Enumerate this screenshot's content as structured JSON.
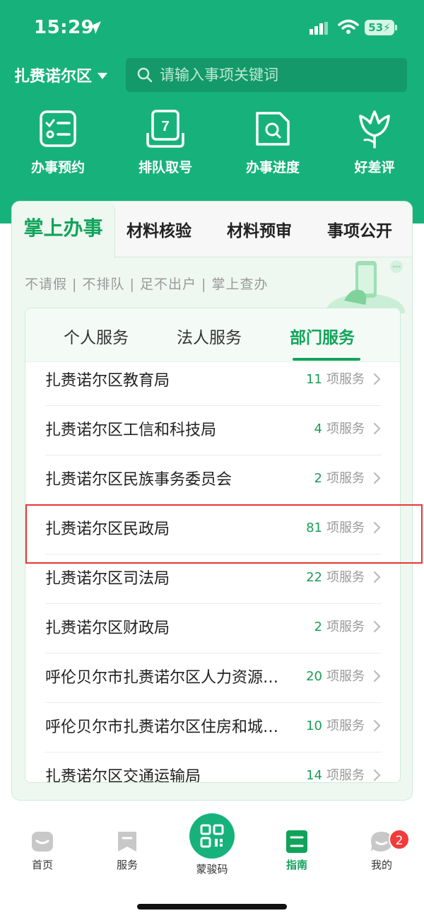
{
  "status_bar": {
    "time": "15:29",
    "battery": "53"
  },
  "header": {
    "region": "扎赉诺尔区",
    "search_placeholder": "请输入事项关键词"
  },
  "quick_actions": [
    {
      "label": "办事预约",
      "icon": "checklist-icon"
    },
    {
      "label": "排队取号",
      "icon": "queue-number-icon",
      "badge_text": "7"
    },
    {
      "label": "办事进度",
      "icon": "progress-search-icon"
    },
    {
      "label": "好差评",
      "icon": "flower-icon"
    }
  ],
  "main_tabs": [
    "掌上办事",
    "材料核验",
    "材料预审",
    "事项公开"
  ],
  "slogan": "不请假 | 不排队 | 足不出户 | 掌上查办",
  "sub_tabs": [
    "个人服务",
    "法人服务",
    "部门服务"
  ],
  "active_sub_tab": "部门服务",
  "departments": [
    {
      "name": "扎赉诺尔区教育局",
      "count": "11",
      "suffix": "项服务"
    },
    {
      "name": "扎赉诺尔区工信和科技局",
      "count": "4",
      "suffix": "项服务"
    },
    {
      "name": "扎赉诺尔区民族事务委员会",
      "count": "2",
      "suffix": "项服务"
    },
    {
      "name": "扎赉诺尔区民政局",
      "count": "81",
      "suffix": "项服务"
    },
    {
      "name": "扎赉诺尔区司法局",
      "count": "22",
      "suffix": "项服务"
    },
    {
      "name": "扎赉诺尔区财政局",
      "count": "2",
      "suffix": "项服务"
    },
    {
      "name": "呼伦贝尔市扎赉诺尔区人力资源…",
      "count": "20",
      "suffix": "项服务"
    },
    {
      "name": "呼伦贝尔市扎赉诺尔区住房和城…",
      "count": "10",
      "suffix": "项服务"
    },
    {
      "name": "扎赉诺尔区交通运输局",
      "count": "14",
      "suffix": "项服务"
    }
  ],
  "bottom_nav": {
    "home": "首页",
    "service": "服务",
    "qr": "蒙骏码",
    "guide": "指南",
    "mine": "我的",
    "mine_badge": "2"
  },
  "colors": {
    "brand": "#17b27c",
    "accent": "#12a35b",
    "highlight": "#e53935",
    "badge": "#f23b3b"
  }
}
